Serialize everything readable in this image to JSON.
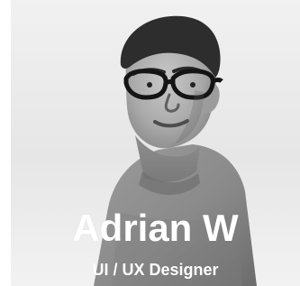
{
  "profile": {
    "name": "Adrian W",
    "role": "UI / UX Designer",
    "photo": {
      "icon": "person-portrait-photo"
    }
  }
}
